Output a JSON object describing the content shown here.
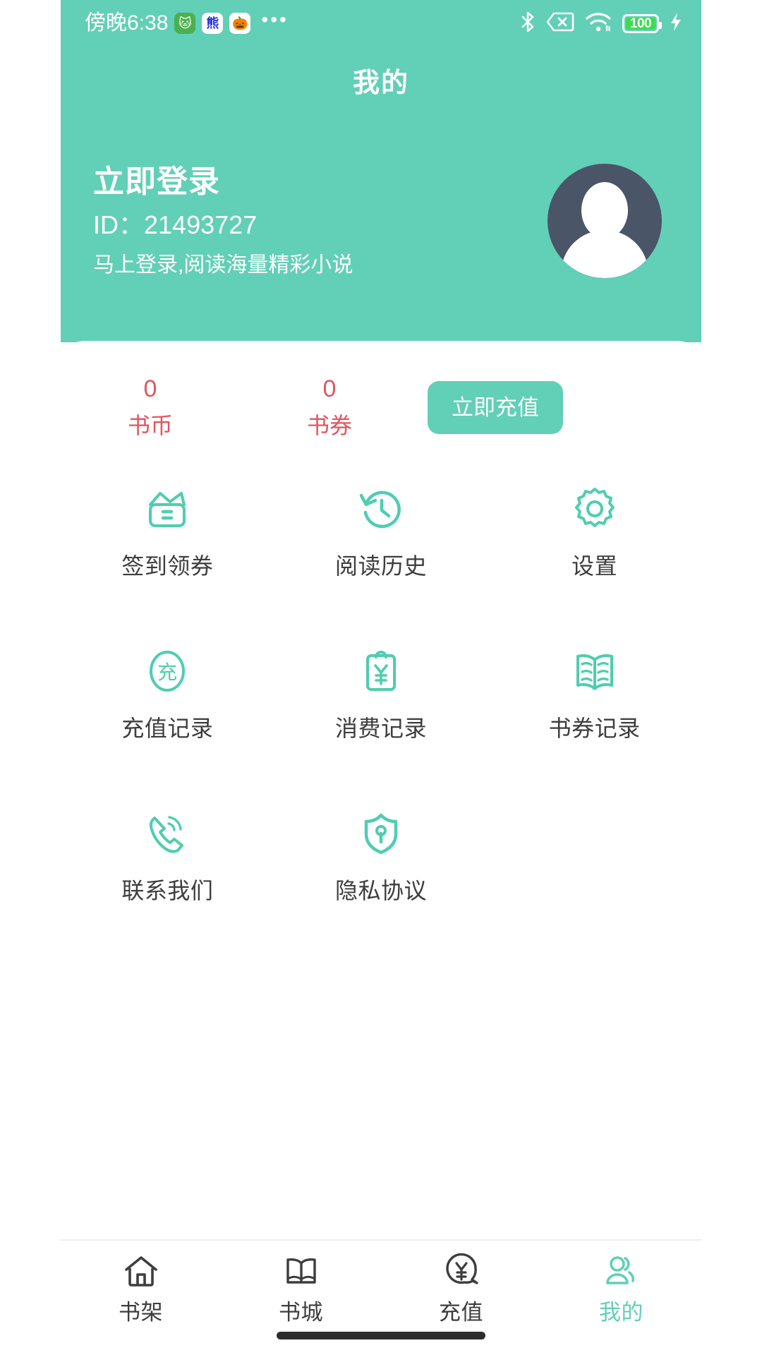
{
  "status_bar": {
    "clock": "傍晚6:38",
    "overflow_dots": "•••",
    "battery_level": "100",
    "icons": [
      "app-icon-green",
      "app-icon-baidu",
      "app-icon-orange",
      "bluetooth-icon",
      "sim-card-off-icon",
      "wifi-icon",
      "battery-icon",
      "charging-bolt-icon"
    ]
  },
  "header": {
    "title": "我的",
    "accent_color": "#62cfb7"
  },
  "profile": {
    "login_title": "立即登录",
    "user_id": "ID：21493727",
    "subtitle": "马上登录,阅读海量精彩小说",
    "avatar_alt": "default-avatar"
  },
  "balance": {
    "accent_color": "#e0565f",
    "items": [
      {
        "value": "0",
        "label": "书币"
      },
      {
        "value": "0",
        "label": "书券"
      }
    ],
    "recharge_label": "立即充值"
  },
  "menu": {
    "items": [
      {
        "label": "签到领券",
        "icon": "wallet-icon"
      },
      {
        "label": "阅读历史",
        "icon": "history-clock-icon"
      },
      {
        "label": "设置",
        "icon": "gear-icon"
      },
      {
        "label": "充值记录",
        "icon": "recharge-circle-icon"
      },
      {
        "label": "消费记录",
        "icon": "clipboard-yen-icon"
      },
      {
        "label": "书券记录",
        "icon": "open-book-icon"
      },
      {
        "label": "联系我们",
        "icon": "phone-ring-icon"
      },
      {
        "label": "隐私协议",
        "icon": "shield-lock-icon"
      }
    ]
  },
  "bottom_nav": {
    "active_color": "#62cfb7",
    "items": [
      {
        "label": "书架",
        "icon": "home-icon",
        "active": false
      },
      {
        "label": "书城",
        "icon": "book-icon",
        "active": false
      },
      {
        "label": "充值",
        "icon": "yen-bubble-icon",
        "active": false
      },
      {
        "label": "我的",
        "icon": "users-icon",
        "active": true
      }
    ]
  }
}
